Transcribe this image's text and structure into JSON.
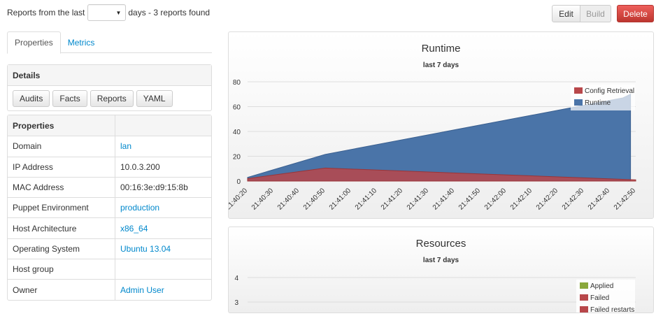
{
  "topbar": {
    "prefix": "Reports from the last",
    "days_selected": "",
    "suffix": "days - 3 reports found"
  },
  "actions": {
    "edit": "Edit",
    "build": "Build",
    "delete": "Delete"
  },
  "tabs": [
    {
      "label": "Properties",
      "active": true
    },
    {
      "label": "Metrics",
      "active": false
    }
  ],
  "details": {
    "title": "Details",
    "buttons": [
      "Audits",
      "Facts",
      "Reports",
      "YAML"
    ]
  },
  "properties": {
    "header": "Properties",
    "rows": [
      {
        "name": "Domain",
        "value": "lan",
        "link": true
      },
      {
        "name": "IP Address",
        "value": "10.0.3.200",
        "link": false
      },
      {
        "name": "MAC Address",
        "value": "00:16:3e:d9:15:8b",
        "link": false
      },
      {
        "name": "Puppet Environment",
        "value": "production",
        "link": true
      },
      {
        "name": "Host Architecture",
        "value": "x86_64",
        "link": true
      },
      {
        "name": "Operating System",
        "value": "Ubuntu 13.04",
        "link": true
      },
      {
        "name": "Host group",
        "value": "",
        "link": false
      },
      {
        "name": "Owner",
        "value": "Admin User",
        "link": true
      }
    ]
  },
  "colors": {
    "runtime": "#4a74a8",
    "config_retrieval": "#b8474a",
    "applied": "#8aa83c",
    "failed": "#b8474a",
    "link": "#0088cc",
    "delete": "#d9403c"
  },
  "chart_data": [
    {
      "type": "area",
      "title": "Runtime",
      "subtitle": "last 7 days",
      "x": [
        "21:40:20",
        "21:40:30",
        "21:40:40",
        "21:40:50",
        "21:41:00",
        "21:41:10",
        "21:41:20",
        "21:41:30",
        "21:41:40",
        "21:41:50",
        "21:42:00",
        "21:42:10",
        "21:42:20",
        "21:42:30",
        "21:42:40",
        "21:42:50"
      ],
      "ylim": [
        0,
        80
      ],
      "yticks": [
        0,
        20,
        40,
        60,
        80
      ],
      "legend_position": "top-right",
      "stacked": true,
      "series": [
        {
          "name": "Config Retrieval",
          "points": [
            [
              "21:40:20",
              2
            ],
            [
              "21:40:50",
              10.5
            ],
            [
              "21:42:50",
              1
            ]
          ]
        },
        {
          "name": "Runtime",
          "points": [
            [
              "21:40:20",
              3
            ],
            [
              "21:40:50",
              21.5
            ],
            [
              "21:42:45",
              67
            ],
            [
              "21:42:48",
              70
            ]
          ]
        }
      ]
    },
    {
      "type": "area",
      "title": "Resources",
      "subtitle": "last 7 days",
      "yticks": [
        3,
        4
      ],
      "legend_position": "top-right",
      "series": [
        {
          "name": "Applied",
          "values": []
        },
        {
          "name": "Failed",
          "values": []
        },
        {
          "name": "Failed restarts",
          "values": []
        }
      ]
    }
  ]
}
